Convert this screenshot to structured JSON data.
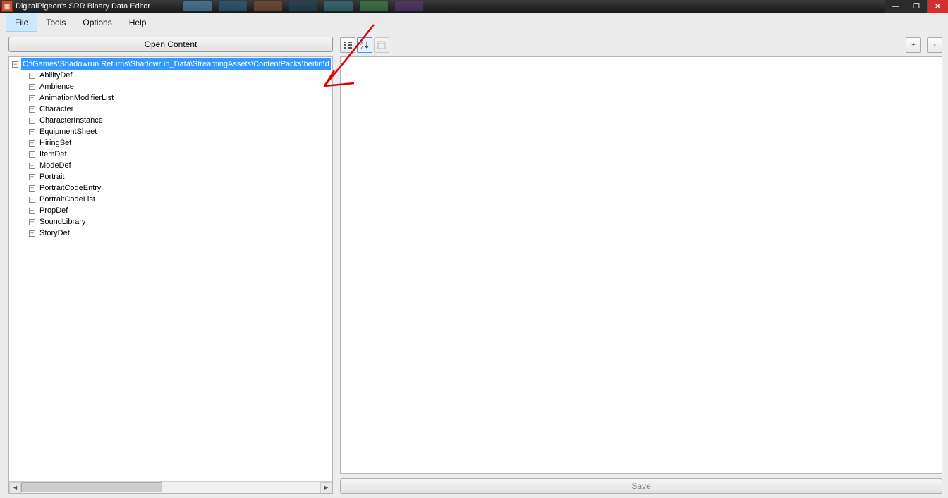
{
  "window": {
    "title": "DigitalPigeon's SRR Binary Data Editor"
  },
  "menu": {
    "items": [
      "File",
      "Tools",
      "Options",
      "Help"
    ],
    "active_index": 0
  },
  "left": {
    "open_button": "Open Content",
    "root_path": "C:\\Games\\Shadowrun Returns\\Shadowrun_Data\\StreamingAssets\\ContentPacks\\berlin\\d",
    "children": [
      "AbilityDef",
      "Ambience",
      "AnimationModifierList",
      "Character",
      "CharacterInstance",
      "EquipmentSheet",
      "HiringSet",
      "ItemDef",
      "ModeDef",
      "Portrait",
      "PortraitCodeEntry",
      "PortraitCodeList",
      "PropDef",
      "SoundLibrary",
      "StoryDef"
    ]
  },
  "right": {
    "plus": "+",
    "minus": "-",
    "save": "Save"
  }
}
